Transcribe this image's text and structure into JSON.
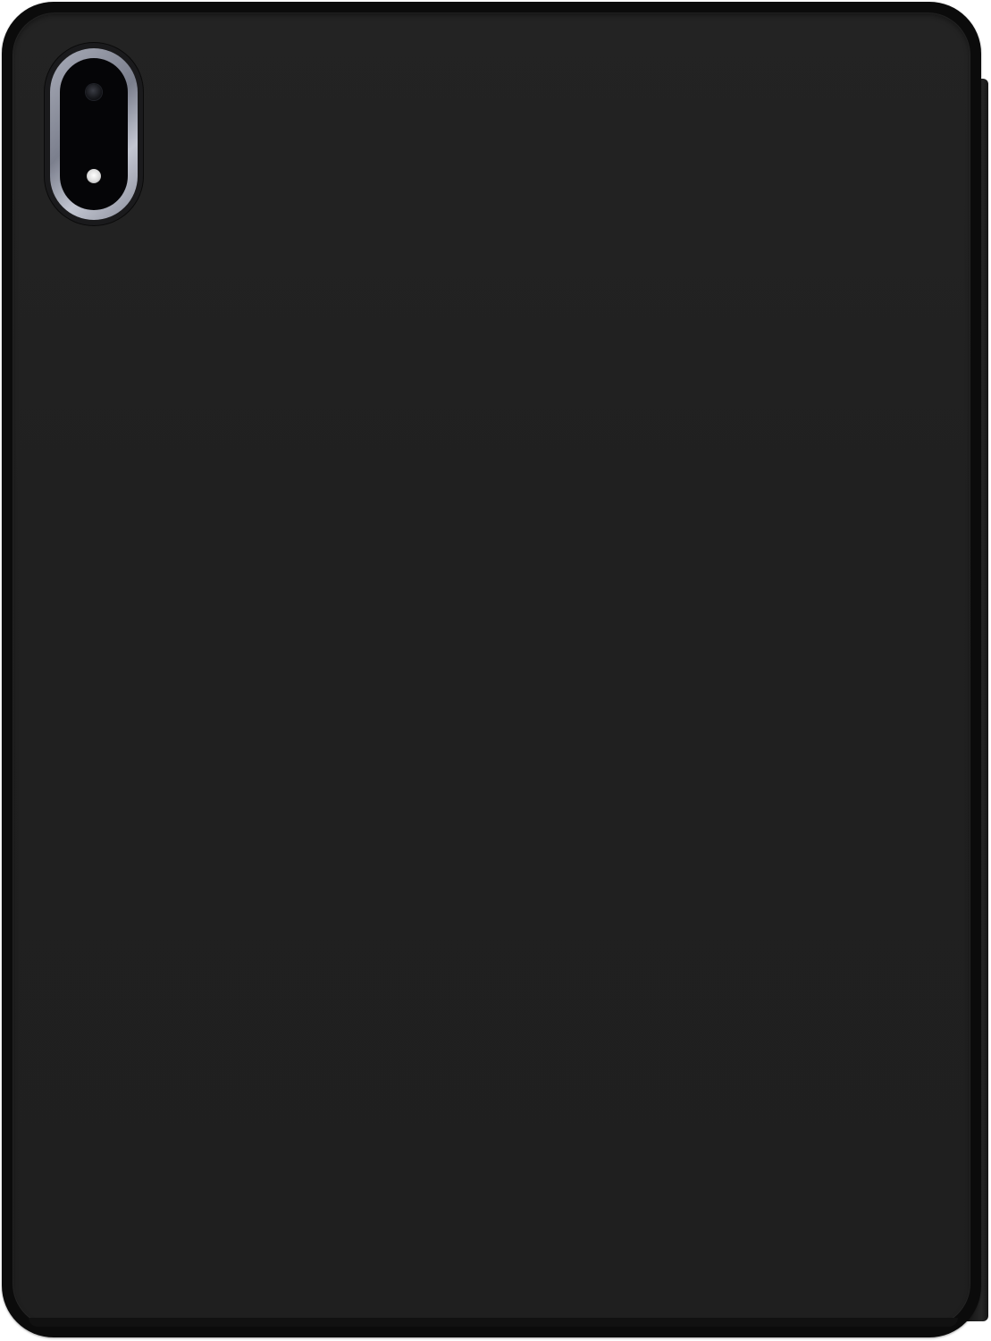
{
  "image": {
    "subject": "",
    "colors": {
      "background": "#ffffff",
      "case": "#202020",
      "case_edge": "#0b0b0b",
      "camera_ring": "#9a9eab",
      "flash": "#ffffff"
    }
  }
}
